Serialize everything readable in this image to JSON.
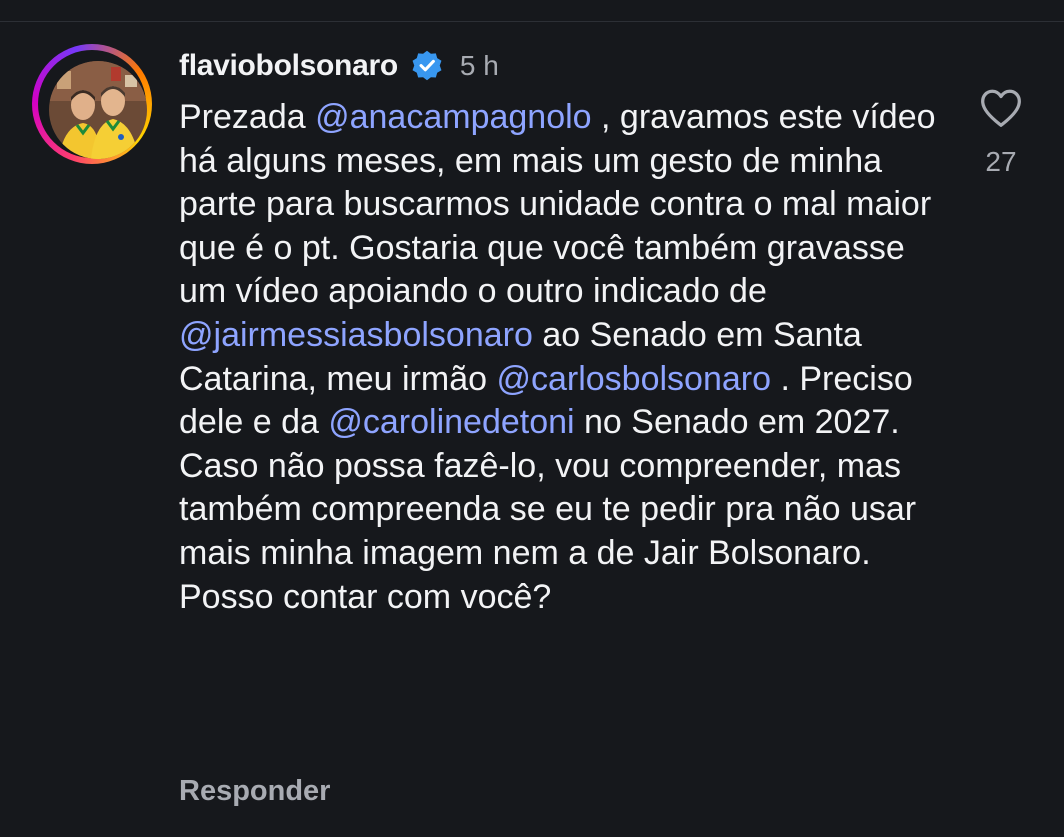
{
  "comment": {
    "username": "flaviobolsonaro",
    "verified_icon": "verified-badge-icon",
    "time": "5 h",
    "segments": [
      {
        "type": "text",
        "value": "Prezada "
      },
      {
        "type": "mention",
        "value": "@anacampagnolo"
      },
      {
        "type": "text",
        "value": " , gravamos este vídeo há alguns meses, em mais um gesto de minha parte para buscarmos unidade contra o mal maior que é o pt. Gostaria que você também gravasse um vídeo apoiando o outro indicado de "
      },
      {
        "type": "mention",
        "value": "@jairmessiasbolsonaro"
      },
      {
        "type": "text",
        "value": " ao Senado em Santa Catarina, meu irmão "
      },
      {
        "type": "mention",
        "value": "@carlosbolsonaro"
      },
      {
        "type": "text",
        "value": " . Preciso dele e da "
      },
      {
        "type": "mention",
        "value": "@carolinedetoni"
      },
      {
        "type": "text",
        "value": " no Senado em 2027. Caso não possa fazê-lo, vou compreender, mas também compreenda se eu te pedir pra não usar mais minha imagem nem a de Jair Bolsonaro. Posso contar com você?"
      }
    ],
    "reply_label": "Responder",
    "like_count": "27",
    "like_icon": "heart-outline-icon"
  },
  "colors": {
    "background": "#16181c",
    "text": "#f2f3f5",
    "secondary": "#a8abb2",
    "mention": "#8ea4ff",
    "verified": "#3897f0"
  }
}
